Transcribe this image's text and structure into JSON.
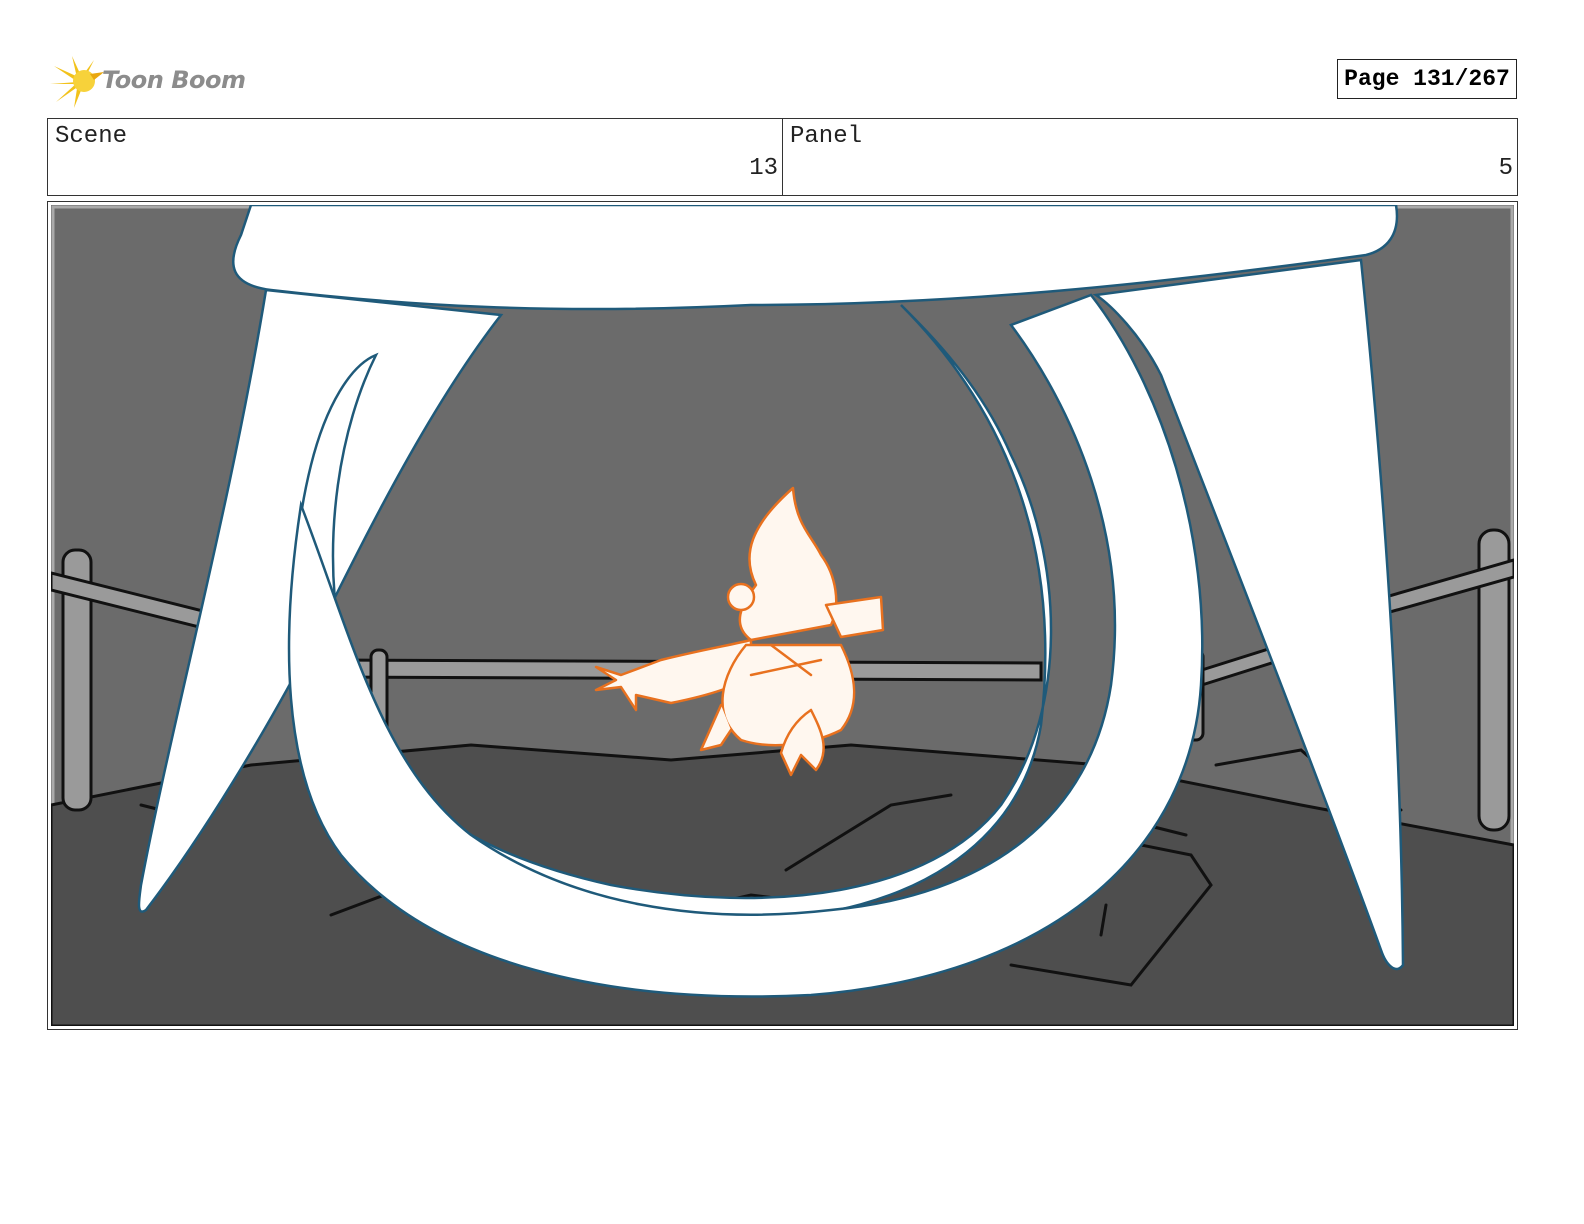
{
  "header": {
    "logo_text": "Toon Boom",
    "logo_icon": "toon-boom-burst-icon",
    "page_label": "Page 131/267"
  },
  "info": {
    "scene_label": "Scene",
    "scene_value": "13",
    "panel_label": "Panel",
    "panel_value": "5"
  },
  "colors": {
    "logo_yellow": "#f2c21b",
    "logo_text": "#8c8c8c",
    "background_gray": "#666666",
    "ground_dark": "#4d4d4d",
    "outline_teal": "#1f5a7a",
    "character_orange": "#e8711f"
  }
}
